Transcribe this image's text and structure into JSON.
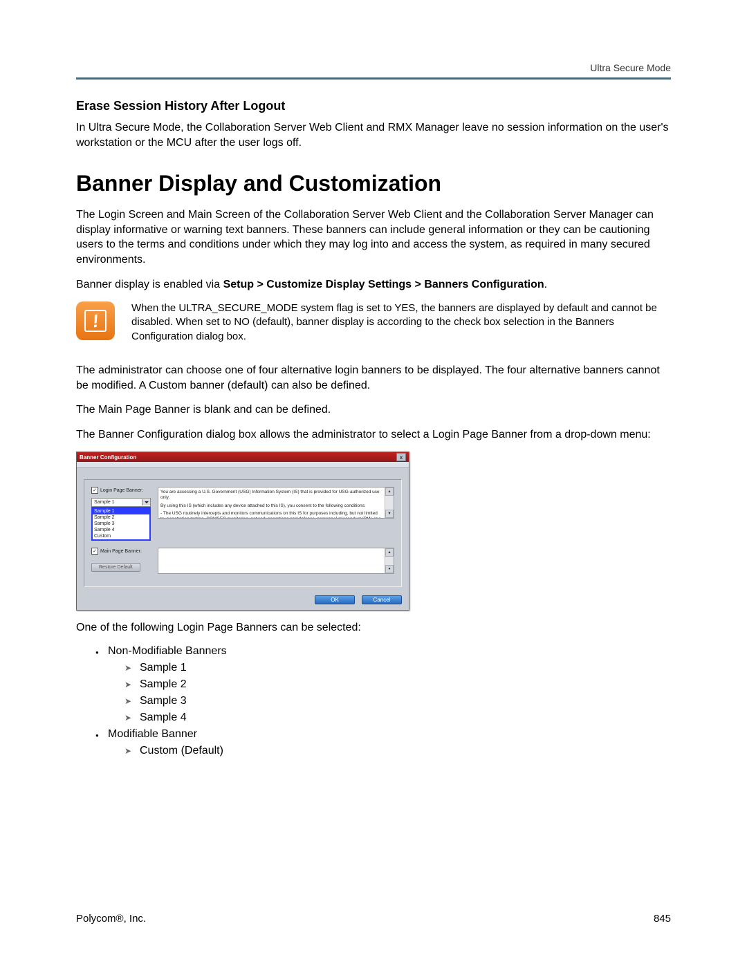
{
  "header": {
    "running_head": "Ultra Secure Mode"
  },
  "section1": {
    "heading": "Erase Session History After Logout",
    "para": "In Ultra Secure Mode, the Collaboration Server Web Client and RMX Manager leave no session information on the user's workstation or the MCU after the user logs off."
  },
  "section2": {
    "heading": "Banner Display and Customization",
    "para1": "The Login Screen and Main Screen of the Collaboration Server Web Client and the Collaboration Server Manager can display informative or warning text banners. These banners can include general information or they can be cautioning users to the terms and conditions under which they may log into and access the system, as required in many secured environments.",
    "enable_prefix": "Banner display is enabled via ",
    "enable_path": "Setup > Customize Display Settings > Banners Configuration",
    "enable_suffix": ".",
    "note": "When the ULTRA_SECURE_MODE system flag is set to YES, the banners are displayed by default and cannot be disabled. When set to NO (default), banner display is according to the check box selection in the Banners Configuration dialog box.",
    "para2": "The administrator can choose one of four alternative login banners to be displayed. The four alternative banners cannot be modified. A Custom banner (default) can also be defined.",
    "para3": "The Main Page Banner is blank and can be defined.",
    "para4": "The Banner Configuration dialog box allows the administrator to select a Login Page Banner from a drop-down menu:"
  },
  "dialog": {
    "title": "Banner Configuration",
    "login_label": "Login Page Banner:",
    "select_value": "Sample 1",
    "options": [
      "Sample 1",
      "Sample 2",
      "Sample 3",
      "Sample 4",
      "Custom"
    ],
    "selected_index": 0,
    "login_text_l1": "You are accessing a U.S. Government (USG) Information System (IS) that is provided for USG-authorized use only.",
    "login_text_l2": "By using this IS (which includes any device attached to this IS), you consent to the following conditions:",
    "login_text_l3": "- The USG routinely intercepts and monitors communications on this IS for purposes including, but not limited to, penetration testing, COMSEC monitoring, network operations and defense, personnel misconduct (PM), law enforcement",
    "main_label": "Main Page Banner:",
    "restore_label": "Restore Default",
    "ok_label": "OK",
    "cancel_label": "Cancel"
  },
  "after_dialog": "One of the following Login Page Banners can be selected:",
  "list": {
    "nonmod_label": "Non-Modifiable Banners",
    "samples": [
      "Sample 1",
      "Sample 2",
      "Sample 3",
      "Sample 4"
    ],
    "mod_label": "Modifiable Banner",
    "custom": "Custom (Default)"
  },
  "footer": {
    "company": "Polycom®, Inc.",
    "page": "845"
  }
}
